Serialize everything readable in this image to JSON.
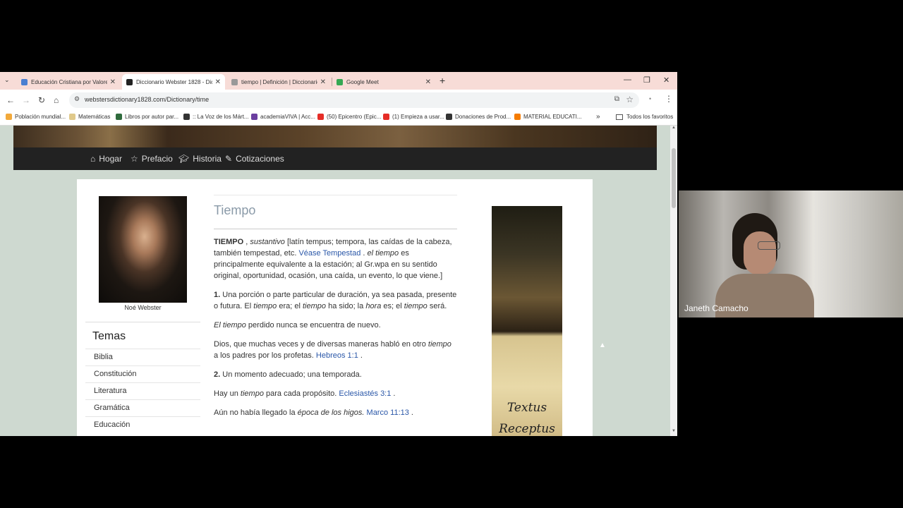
{
  "browser": {
    "tabs": [
      {
        "title": "Educación Cristiana por Valores",
        "color": "#4a7fd1",
        "active": false
      },
      {
        "title": "Diccionario Webster 1828 - Dic",
        "color": "#222222",
        "active": true
      },
      {
        "title": "tiempo | Definición | Diccionario",
        "color": "#888888",
        "active": false
      },
      {
        "title": "Google Meet",
        "color": "#34a853",
        "active": false
      }
    ],
    "url": "webstersdictionary1828.com/Dictionary/time",
    "bookmarks": [
      {
        "label": "Población mundial...",
        "color": "#f2a93b"
      },
      {
        "label": "Matemáticas",
        "color": "#e0c98a"
      },
      {
        "label": "Libros por autor par...",
        "color": "#2f6b3d"
      },
      {
        "label": ":: La Voz de los Márt...",
        "color": "#333333"
      },
      {
        "label": "academiaVIVA | Acc...",
        "color": "#6b3fa0"
      },
      {
        "label": "(50) Epicentro (Epic...",
        "color": "#e52d27"
      },
      {
        "label": "(1) Empieza a usar...",
        "color": "#e52d27"
      },
      {
        "label": "Donaciones de Prod...",
        "color": "#333333"
      },
      {
        "label": "MATERIAL EDUCATI...",
        "color": "#f57c00"
      }
    ],
    "all_bookmarks": "Todos los favoritos"
  },
  "site": {
    "nav": [
      {
        "label": "Hogar",
        "icon": "home-icon"
      },
      {
        "label": "Prefacio",
        "icon": "star-icon"
      },
      {
        "label": "Historia",
        "icon": "graduation-cap-icon"
      },
      {
        "label": "Cotizaciones",
        "icon": "pin-icon"
      }
    ],
    "portrait_caption": "Noé Webster",
    "topics_title": "Temas",
    "topics": [
      "Biblia",
      "Constitución",
      "Literatura",
      "Gramática",
      "Educación"
    ],
    "entry_title": "Tiempo",
    "entry": {
      "headword": "TIEMPO",
      "pos": "sustantivo",
      "etym_a": "[latín tempus; tempora, las caídas de la cabeza, también tempestad, etc.",
      "etym_link": "Véase Tempestad",
      "etym_b": ".",
      "etym_em": "el tiempo",
      "etym_c": "es principalmente equivalente a la estación; al Gr.wpa en su sentido original, oportunidad, ocasión, una caída, un evento, lo que viene.]",
      "def1_num": "1.",
      "def1_a": "Una porción o parte particular de duración, ya sea pasada, presente o futura. El",
      "def1_em1": "tiempo",
      "def1_b": "era; el",
      "def1_em2": "tiempo",
      "def1_c": "ha sido; la",
      "def1_em3": "hora",
      "def1_d": "es; el",
      "def1_em4": "tiempo",
      "def1_e": "será.",
      "ex1_em": "El tiempo",
      "ex1": "perdido nunca se encuentra de nuevo.",
      "ex2_a": "Dios, que muchas veces y de diversas maneras habló en otro",
      "ex2_em": "tiempo",
      "ex2_b": "a los padres por los profetas.",
      "ex2_link": "Hebreos 1:1",
      "ex2_c": ".",
      "def2_num": "2.",
      "def2": "Un momento adecuado; una temporada.",
      "ex3_a": "Hay un",
      "ex3_em": "tiempo",
      "ex3_b": "para cada propósito.",
      "ex3_link": "Eclesiastés 3:1",
      "ex3_c": ".",
      "ex4_a": "Aún no había llegado la",
      "ex4_em": "época de los higos.",
      "ex4_link": "Marco 11:13",
      "ex4_c": "."
    },
    "ad_line1": "Textus",
    "ad_line2": "Receptus"
  },
  "meet": {
    "participant": "Janeth Camacho"
  }
}
